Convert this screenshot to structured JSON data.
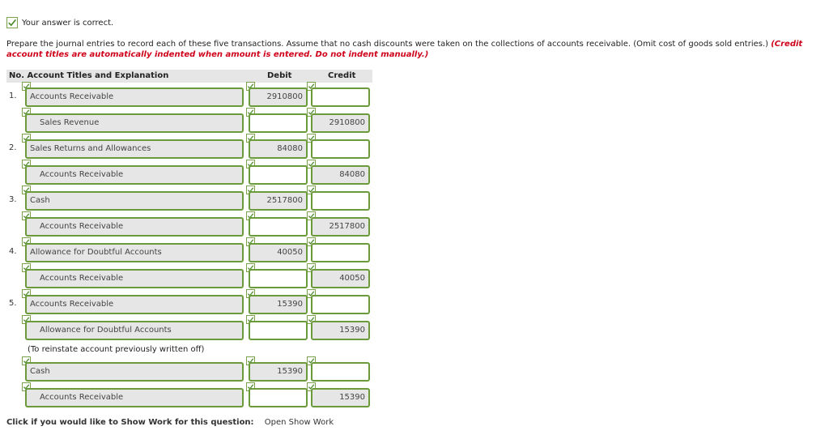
{
  "part_label": "(a)",
  "status": "Your answer is correct.",
  "instructions": {
    "text": "Prepare the journal entries to record each of these five transactions. Assume that no cash discounts were taken on the collections of accounts receivable. (Omit cost of goods sold entries.) ",
    "red": "(Credit account titles are automatically indented when amount is entered. Do not indent manually.)"
  },
  "table": {
    "headers": {
      "no_title": "No. Account Titles and Explanation",
      "debit": "Debit",
      "credit": "Credit"
    },
    "rows": [
      {
        "no": "1.",
        "account": "Accounts Receivable",
        "debit": "2910800",
        "credit": ""
      },
      {
        "no": "",
        "account": "Sales Revenue",
        "debit": "",
        "credit": "2910800"
      },
      {
        "no": "2.",
        "account": "Sales Returns and Allowances",
        "debit": "84080",
        "credit": ""
      },
      {
        "no": "",
        "account": "Accounts Receivable",
        "debit": "",
        "credit": "84080"
      },
      {
        "no": "3.",
        "account": "Cash",
        "debit": "2517800",
        "credit": ""
      },
      {
        "no": "",
        "account": "Accounts Receivable",
        "debit": "",
        "credit": "2517800"
      },
      {
        "no": "4.",
        "account": "Allowance for Doubtful Accounts",
        "debit": "40050",
        "credit": ""
      },
      {
        "no": "",
        "account": "Accounts Receivable",
        "debit": "",
        "credit": "40050"
      },
      {
        "no": "5.",
        "account": "Accounts Receivable",
        "debit": "15390",
        "credit": ""
      },
      {
        "no": "",
        "account": "Allowance for Doubtful Accounts",
        "debit": "",
        "credit": "15390"
      },
      {
        "no": "",
        "account": "Cash",
        "debit": "15390",
        "credit": ""
      },
      {
        "no": "",
        "account": "Accounts Receivable",
        "debit": "",
        "credit": "15390"
      }
    ],
    "note": "(To reinstate account previously written off)"
  },
  "footer": {
    "prompt": "Click if you would like to Show Work for this question:",
    "link": "Open Show Work"
  }
}
